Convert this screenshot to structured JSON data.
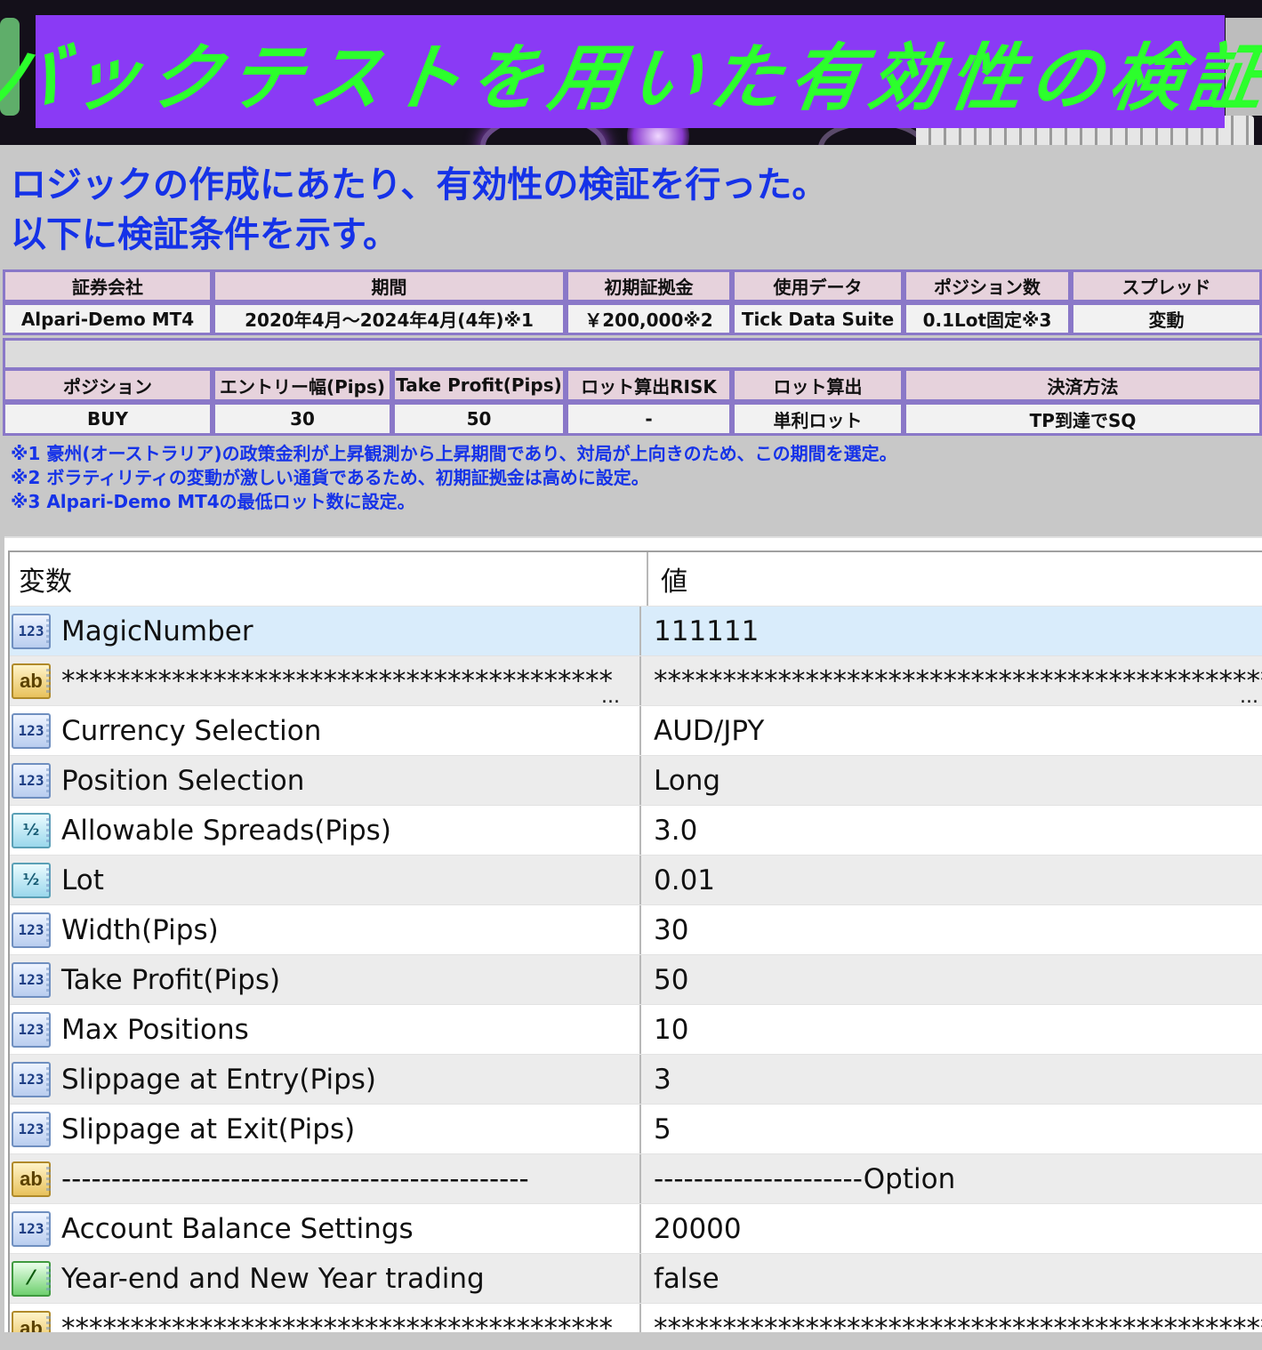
{
  "banner": {
    "title": "バックテストを用いた有効性の検証",
    "box_color": "#8a3af5",
    "text_color": "#2cff2c"
  },
  "intro": {
    "line1": "ロジックの作成にあたり、有効性の検証を行った。",
    "line2": "以下に検証条件を示す。"
  },
  "conditions1": {
    "headers": [
      "証券会社",
      "期間",
      "初期証拠金",
      "使用データ",
      "ポジション数",
      "スプレッド"
    ],
    "values": [
      "Alpari-Demo MT4",
      "2020年4月～2024年4月(4年)※1",
      "￥200,000※2",
      "Tick Data Suite",
      "0.1Lot固定※3",
      "変動"
    ]
  },
  "conditions2": {
    "headers": [
      "ポジション",
      "エントリー幅(Pips)",
      "Take Profit(Pips)",
      "ロット算出RISK",
      "ロット算出",
      "決済方法"
    ],
    "values": [
      "BUY",
      "30",
      "50",
      "-",
      "単利ロット",
      "TP到達でSQ"
    ]
  },
  "notes": [
    "※1 豪州(オーストラリア)の政策金利が上昇観測から上昇期間であり、対局が上向きのため、この期間を選定。",
    "※2 ボラティリティの変動が激しい通貨であるため、初期証拠金は高めに設定。",
    "※3 Alpari-Demo MT4の最低ロット数に設定。"
  ],
  "params": {
    "header": {
      "name": "変数",
      "value": "値"
    },
    "rows": [
      {
        "type": "int",
        "icon": "123",
        "name": "MagicNumber",
        "value": "111111",
        "selected": true
      },
      {
        "type": "string",
        "icon": "ab",
        "name": "****************************************",
        "value": "**************************************************",
        "truncated": true
      },
      {
        "type": "int",
        "icon": "123",
        "name": "Currency Selection",
        "value": "AUD/JPY"
      },
      {
        "type": "int",
        "icon": "123",
        "name": "Position Selection",
        "value": "Long"
      },
      {
        "type": "double",
        "icon": "½",
        "name": "Allowable Spreads(Pips)",
        "value": "3.0"
      },
      {
        "type": "double",
        "icon": "½",
        "name": "Lot",
        "value": "0.01"
      },
      {
        "type": "int",
        "icon": "123",
        "name": "Width(Pips)",
        "value": "30"
      },
      {
        "type": "int",
        "icon": "123",
        "name": "Take Profit(Pips)",
        "value": "50"
      },
      {
        "type": "int",
        "icon": "123",
        "name": "Max Positions",
        "value": "10"
      },
      {
        "type": "int",
        "icon": "123",
        "name": "Slippage at Entry(Pips)",
        "value": "3"
      },
      {
        "type": "int",
        "icon": "123",
        "name": "Slippage at Exit(Pips)",
        "value": "5"
      },
      {
        "type": "string",
        "icon": "ab",
        "name": "-----------------------------------------------",
        "value": "---------------------Option"
      },
      {
        "type": "int",
        "icon": "123",
        "name": "Account Balance Settings",
        "value": "20000"
      },
      {
        "type": "bool",
        "icon": "⁄",
        "name": "Year-end and New Year trading",
        "value": "false"
      },
      {
        "type": "string",
        "icon": "ab",
        "name": "****************************************",
        "value": "**************************************************",
        "truncated": true
      }
    ]
  }
}
